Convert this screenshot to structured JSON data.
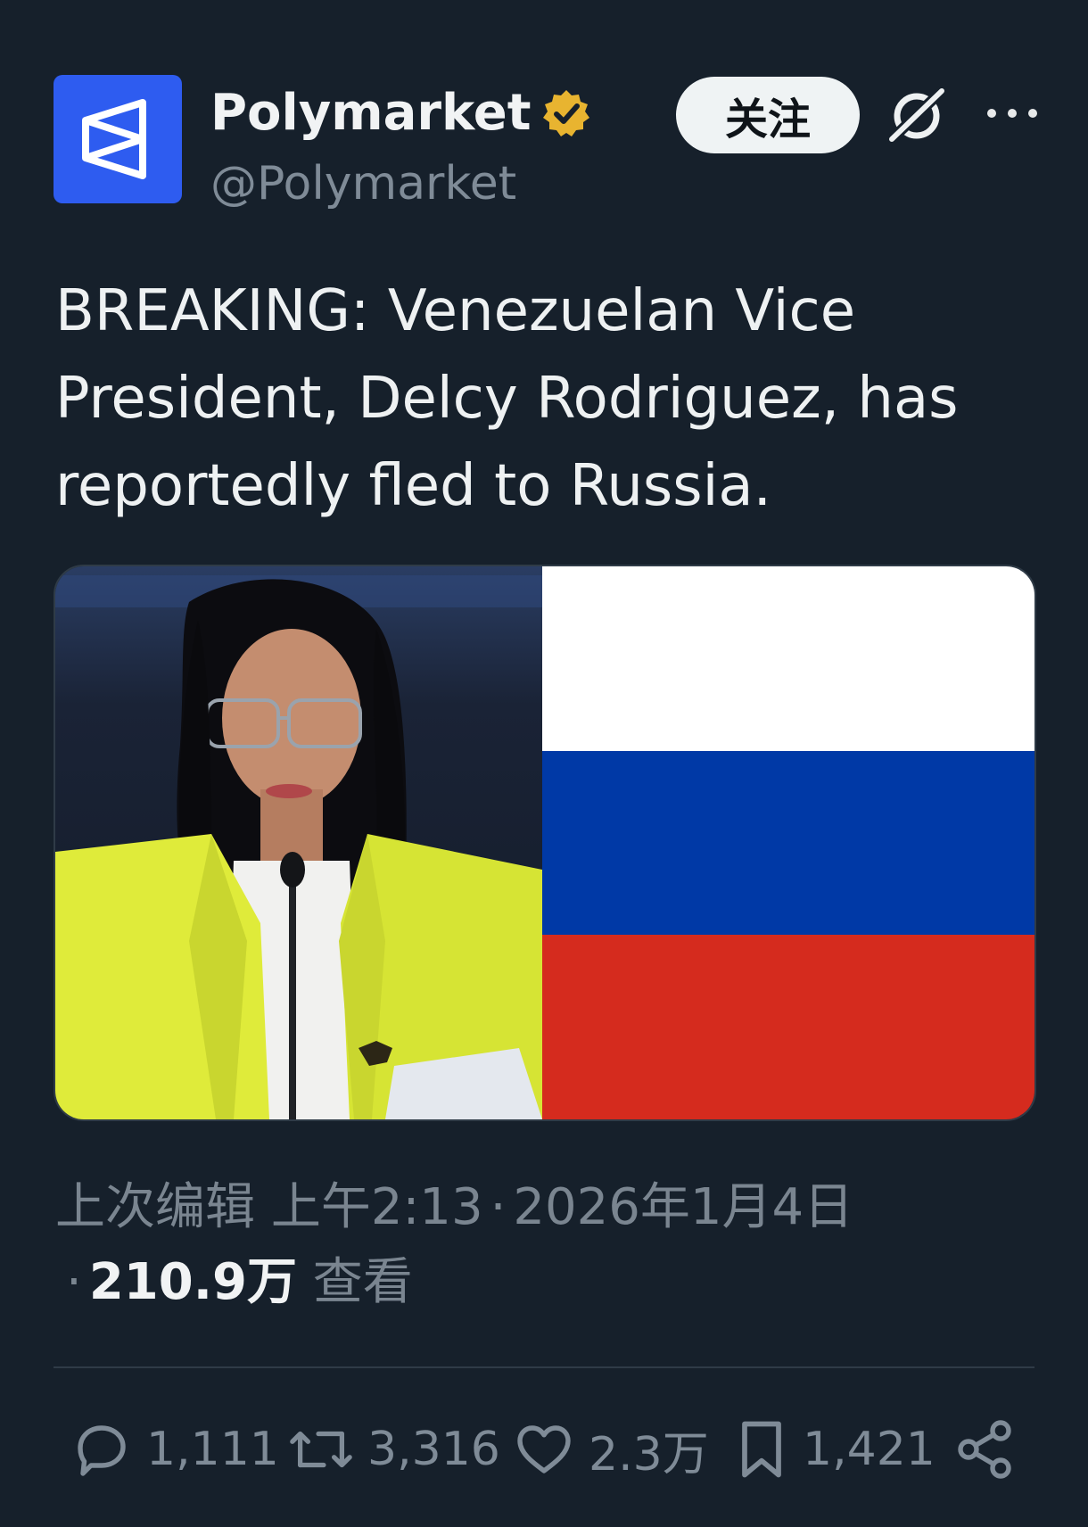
{
  "header": {
    "display_name": "Polymarket",
    "handle": "@Polymarket",
    "follow_label": "关注"
  },
  "tweet": {
    "text": "BREAKING: Venezuelan Vice President, Delcy Rodriguez, has reportedly fled to Russia."
  },
  "meta": {
    "edited_label": "上次编辑",
    "time": "上午2:13",
    "sep1": "·",
    "date": "2026年1月4日",
    "sep2": "·",
    "views_count": "210.9万",
    "views_label": "查看"
  },
  "actions": {
    "replies": "1,111",
    "reposts": "3,316",
    "likes": "2.3万",
    "bookmarks": "1,421"
  },
  "colors": {
    "background": "#16202b",
    "avatar": "#2e5cf0",
    "verified": "#e8b430",
    "flag_white": "#ffffff",
    "flag_blue": "#0039a6",
    "flag_red": "#d52b1e"
  }
}
